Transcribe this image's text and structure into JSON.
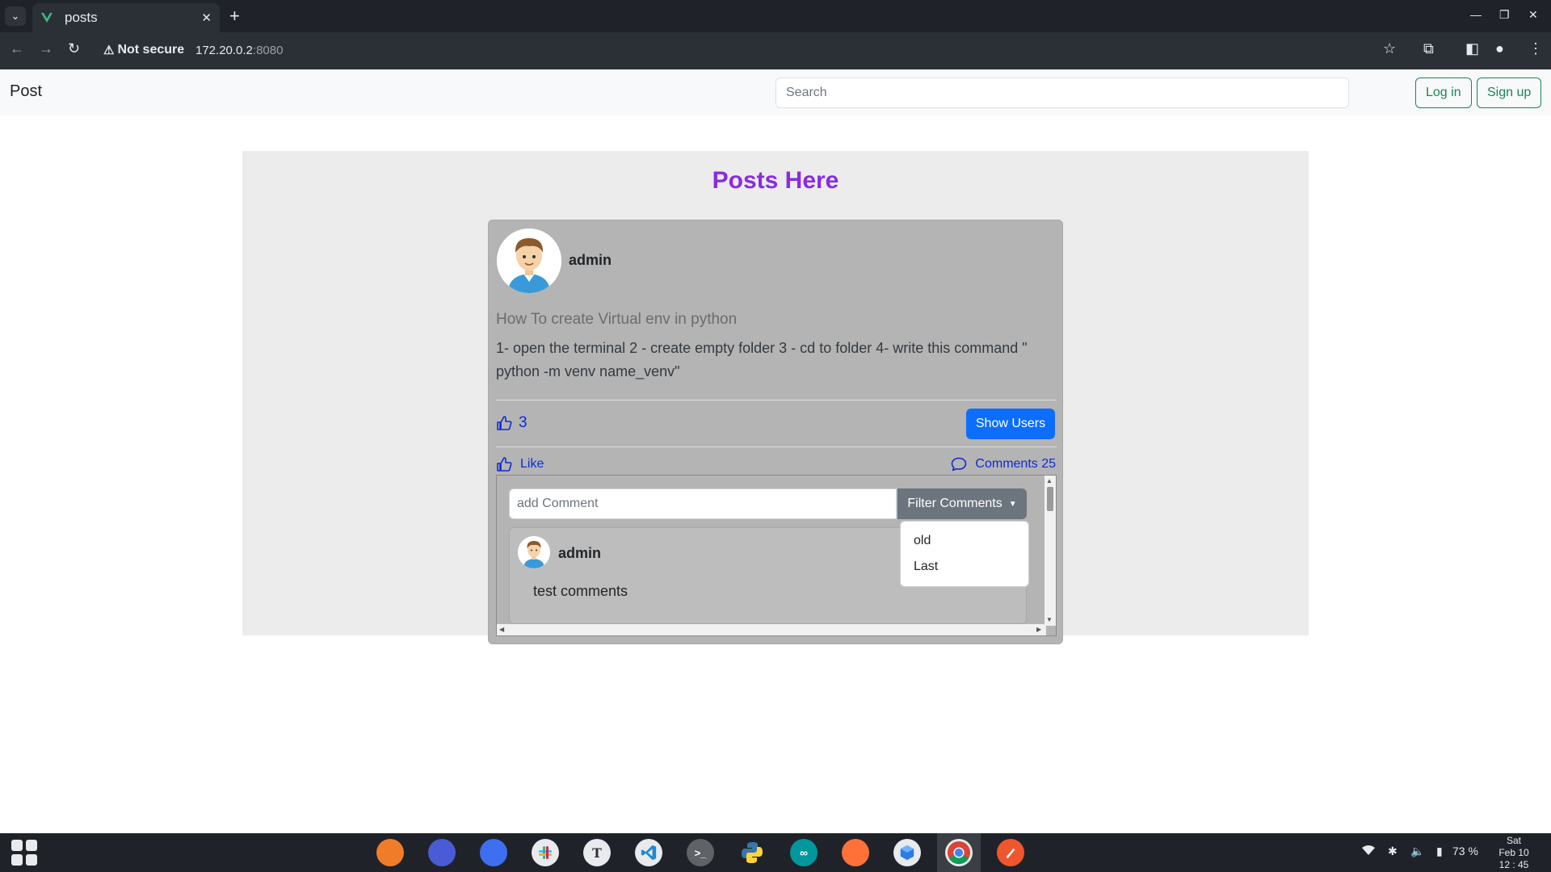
{
  "browser": {
    "tab_title": "posts",
    "security_label": "Not secure",
    "url_host": "172.20.0.2",
    "url_port": ":8080"
  },
  "navbar": {
    "brand": "Post",
    "search_placeholder": "Search",
    "login_label": "Log in",
    "signup_label": "Sign up"
  },
  "page": {
    "heading": "Posts Here"
  },
  "post": {
    "author": "admin",
    "title": "How To create Virtual env in python",
    "body": "1- open the terminal 2 - create empty folder 3 - cd to folder 4- write this command \" python -m venv name_venv\"",
    "like_count": "3",
    "show_users_label": "Show Users",
    "like_label": "Like",
    "comments_label": "Comments 25"
  },
  "comments": {
    "input_placeholder": "add Comment",
    "filter_label": "Filter Comments",
    "filter_options": [
      "old",
      "Last"
    ],
    "items": [
      {
        "author": "admin",
        "text": "test comments"
      }
    ]
  },
  "taskbar": {
    "battery": "73 %",
    "clock_day": "Sat",
    "clock_date": "Feb 10",
    "clock_time": "12 : 45"
  },
  "colors": {
    "heading": "#8a2be2",
    "primary": "#0d6efd",
    "success": "#198754",
    "link": "#0d2bd6"
  }
}
